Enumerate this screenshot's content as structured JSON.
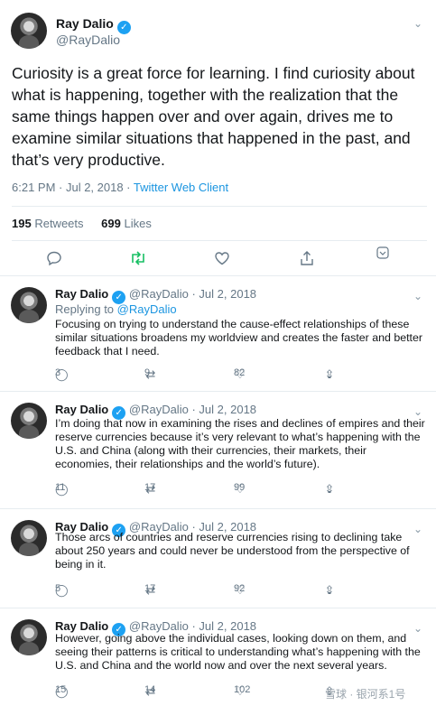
{
  "main_tweet": {
    "name": "Ray Dalio",
    "handle": "@RayDalio",
    "text": "Curiosity is a great force for learning. I find curiosity about what is happening, together with the realization that the same things happen over and over again, drives me to examine similar situations that happened in the past, and that’s very productive.",
    "timestamp": "6:21 PM · Jul 2, 2018 · ",
    "client": "Twitter Web Client",
    "retweets_count": "195",
    "retweets_label": "Retweets",
    "likes_count": "699",
    "likes_label": "Likes",
    "icons": [
      "reply-icon",
      "retweet-icon",
      "like-icon",
      "share-icon",
      "dropdown-icon"
    ],
    "retweet_icon_color": "#17bf63"
  },
  "replies": [
    {
      "name": "Ray Dalio",
      "handle": "@RayDalio",
      "dot": "·",
      "date": "Jul 2, 2018",
      "replying_label": "Replying to ",
      "replying_to": "@RayDalio",
      "text": "Focusing on trying to understand the cause-effect relationships of these similar situations broadens my worldview and creates the faster and better feedback that I need.",
      "reply_count": "3",
      "retweet_count": "9",
      "like_count": "82"
    },
    {
      "name": "Ray Dalio",
      "handle": "@RayDalio",
      "dot": "·",
      "date": "Jul 2, 2018",
      "text": "I’m doing that now in examining the rises and declines of empires and their reserve currencies because it’s very relevant to what’s happening with the U.S. and China (along with their currencies, their markets, their economies, their relationships and the world’s future).",
      "reply_count": "11",
      "retweet_count": "17",
      "like_count": "99"
    },
    {
      "name": "Ray Dalio",
      "handle": "@RayDalio",
      "dot": "·",
      "date": "Jul 2, 2018",
      "text": "Those arcs of countries and reserve currencies rising to declining take about 250 years and could never be understood from the perspective of being in it.",
      "reply_count": "5",
      "retweet_count": "17",
      "like_count": "92"
    },
    {
      "name": "Ray Dalio",
      "handle": "@RayDalio",
      "dot": "·",
      "date": "Jul 2, 2018",
      "text": "However, going above the individual cases, looking down on them, and seeing their patterns is critical to understanding what’s happening with the U.S. and China and the world now and over the next several years.",
      "reply_count": "15",
      "retweet_count": "14",
      "like_count": "102"
    }
  ],
  "watermark": "雪球 · 银河系1号"
}
